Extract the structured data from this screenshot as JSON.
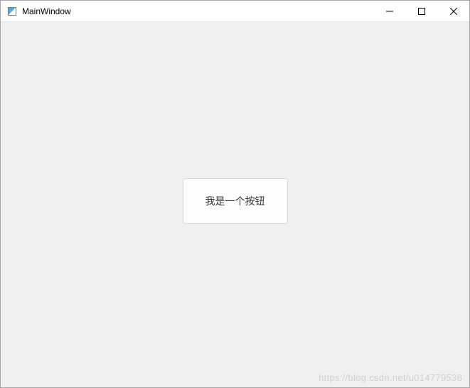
{
  "window": {
    "title": "MainWindow"
  },
  "content": {
    "button_label": "我是一个按钮"
  },
  "watermark": {
    "text": "https://blog.csdn.net/u014779536"
  }
}
